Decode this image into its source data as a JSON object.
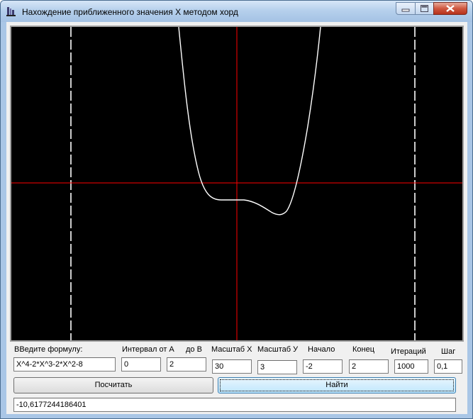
{
  "window": {
    "title": "Нахождение приближенного значения X методом хорд"
  },
  "controls": {
    "formula_label": "ВВедите формулу:",
    "formula_value": "X^4-2*X^3-2*X^2-8",
    "interval_from_label": "Интервал от А",
    "interval_from_value": "0",
    "interval_to_label": "до В",
    "interval_to_value": "2",
    "scale_x_label": "Масштаб  X",
    "scale_x_value": "30",
    "scale_y_label": "Масштаб  У",
    "scale_y_value": "3",
    "start_label": "Начало",
    "start_value": "-2",
    "end_label": "Конец",
    "end_value": "2",
    "iterations_label": "Итераций",
    "iterations_value": "1000",
    "step_label": "Шаг",
    "step_value": "0,1",
    "calculate_button": "Посчитать",
    "find_button": "Найти",
    "result_value": "-10,6177244186401"
  },
  "colors": {
    "plot_background": "#000000",
    "axes": "#ff0000",
    "curve": "#ffffff",
    "interval_lines": "#ffffff"
  },
  "icons": {
    "app": "app-icon",
    "minimize": "minimize-icon",
    "maximize": "maximize-icon",
    "close": "close-icon"
  }
}
